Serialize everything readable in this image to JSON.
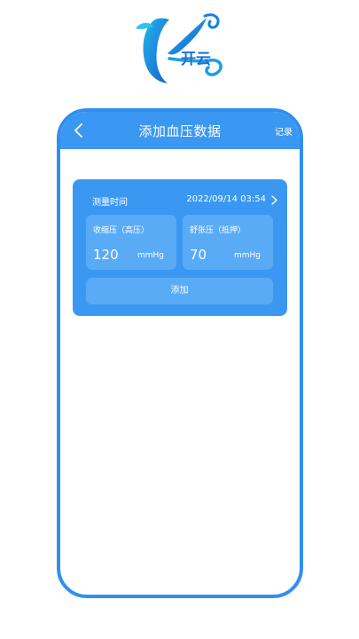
{
  "logo": {
    "text": "开云"
  },
  "nav": {
    "title": "添加血压数据",
    "record_label": "记录"
  },
  "form": {
    "time_label": "测量时间",
    "time_value": "2022/09/14 03:54",
    "systolic": {
      "label": "收缩压（高压）",
      "value": "120",
      "unit": "mmHg"
    },
    "diastolic": {
      "label": "舒张压（抵押）",
      "value": "70",
      "unit": "mmHg"
    },
    "add_label": "添加"
  },
  "colors": {
    "primary": "#3a98f2",
    "primary_light": "#5aabf5",
    "frame": "#2f8ff0",
    "logo_blue": "#1c6fd6"
  },
  "icons": {
    "back": "chevron-left-icon",
    "time_arrow": "chevron-right-icon"
  }
}
